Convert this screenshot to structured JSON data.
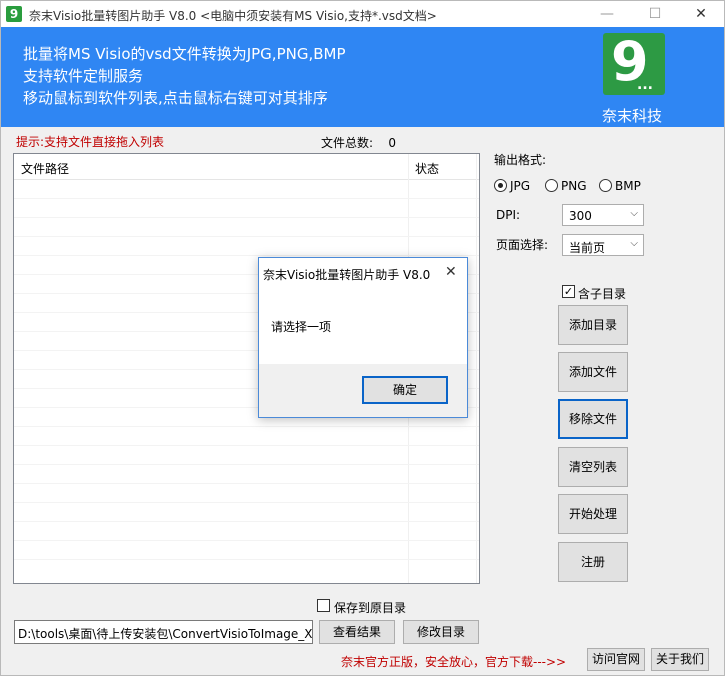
{
  "window": {
    "title": "奈末Visio批量转图片助手  V8.0  <电脑中须安装有MS Visio,支持*.vsd文档>",
    "icon_letter": "9",
    "controls": {
      "minimize": "—",
      "maximize": "☐",
      "close": "✕"
    }
  },
  "banner": {
    "line1": "批量将MS Visio的vsd文件转换为JPG,PNG,BMP",
    "line2": "支持软件定制服务",
    "line3": "移动鼠标到软件列表,点击鼠标右键可对其排序",
    "logo_number": "9",
    "logo_dots": "...",
    "brand": "奈末科技",
    "color": "#2f86f3"
  },
  "tip": "提示:支持文件直接拖入列表",
  "file_count": {
    "label": "文件总数:",
    "value": "0"
  },
  "list": {
    "columns": [
      "文件路径",
      "状态"
    ]
  },
  "options": {
    "format_label": "输出格式:",
    "formats": [
      {
        "label": "JPG",
        "selected": true
      },
      {
        "label": "PNG",
        "selected": false
      },
      {
        "label": "BMP",
        "selected": false
      }
    ],
    "dpi_label": "DPI:",
    "dpi_value": "300",
    "page_label": "页面选择:",
    "page_value": "当前页",
    "subdir_label": "含子目录",
    "subdir_checked": true
  },
  "buttons": {
    "add_dir": "添加目录",
    "add_file": "添加文件",
    "remove_file": "移除文件",
    "clear_list": "清空列表",
    "start": "开始处理",
    "register": "注册",
    "view_result": "查看结果",
    "change_dir": "修改目录",
    "visit_site": "访问官网",
    "about": "关于我们"
  },
  "save_original_label": "保存到原目录",
  "output_path": "D:\\tools\\桌面\\待上传安装包\\ConvertVisioToImage_Xia",
  "promo": "奈末官方正版，安全放心，官方下载--->>",
  "dialog": {
    "title": "奈末Visio批量转图片助手 V8.0",
    "close": "✕",
    "message": "请选择一项",
    "ok": "确定"
  }
}
